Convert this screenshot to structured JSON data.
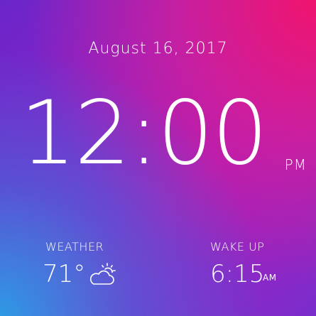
{
  "date": "August 16, 2017",
  "clock": {
    "time": "12:00",
    "period": "PM"
  },
  "weather": {
    "label": "WEATHER",
    "temperature": "71°",
    "icon": "partly-cloudy-icon"
  },
  "wake_up": {
    "label": "WAKE UP",
    "time": "6:15",
    "period": "AM"
  }
}
